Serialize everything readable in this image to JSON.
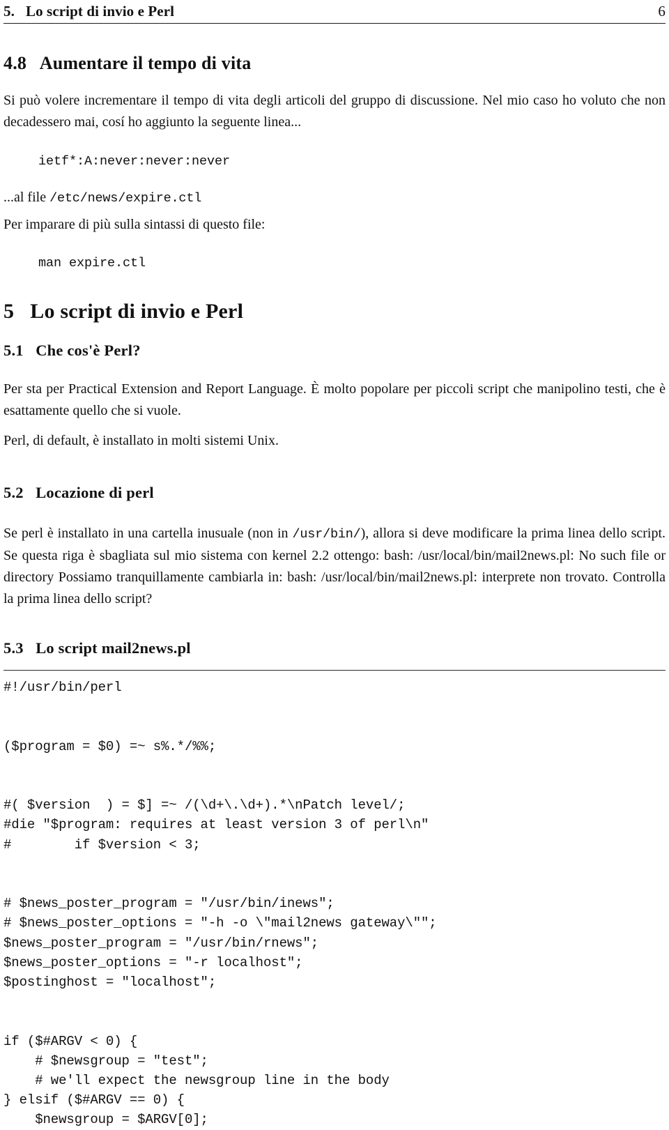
{
  "header": {
    "title": "5.   Lo script di invio e Perl",
    "page_number": "6"
  },
  "sections": {
    "s48": {
      "heading": "4.8   Aumentare il tempo di vita",
      "para1": "Si può volere incrementare il tempo di vita degli articoli del gruppo di discussione. Nel mio caso ho voluto che non decadessero mai, cosí ho aggiunto la seguente linea...",
      "verbatim1": "ietf*:A:never:never:never",
      "para2_prefix": "...al file ",
      "para2_code": "/etc/news/expire.ctl",
      "para3": "Per imparare di più sulla sintassi di questo file:",
      "verbatim2": "man expire.ctl"
    },
    "s5": {
      "heading": "5   Lo script di invio e Perl"
    },
    "s51": {
      "heading": "5.1   Che cos'è Perl?",
      "para1": "Per sta per Practical Extension and Report Language. È molto popolare per piccoli script che manipolino testi, che è esattamente quello che si vuole.",
      "para2": "Perl, di default, è installato in molti sistemi Unix."
    },
    "s52": {
      "heading": "5.2   Locazione di perl",
      "para1_a": "Se perl è installato in una cartella inusuale (non in ",
      "para1_code": "/usr/bin/",
      "para1_b": "), allora si deve modificare la prima linea dello script. Se questa riga è sbagliata sul mio sistema con kernel 2.2 ottengo: bash: /usr/local/bin/mail2news.pl: No such file or directory Possiamo tranquillamente cambiarla in: bash: /usr/local/bin/mail2news.pl: interprete non trovato. Controlla la prima linea dello script?"
    },
    "s53": {
      "heading": "5.3   Lo script mail2news.pl",
      "code_lines": [
        "#!/usr/bin/perl",
        "",
        "",
        "($program = $0) =~ s%.*/%%;",
        "",
        "",
        "#( $version  ) = $] =~ /(\\d+\\.\\d+).*\\nPatch level/;",
        "#die \"$program: requires at least version 3 of perl\\n\"",
        "#        if $version < 3;",
        "",
        "",
        "# $news_poster_program = \"/usr/bin/inews\";",
        "# $news_poster_options = \"-h -o \\\"mail2news gateway\\\"\";",
        "$news_poster_program = \"/usr/bin/rnews\";",
        "$news_poster_options = \"-r localhost\";",
        "$postinghost = \"localhost\";",
        "",
        "",
        "if ($#ARGV < 0) {",
        "    # $newsgroup = \"test\";",
        "    # we'll expect the newsgroup line in the body",
        "} elsif ($#ARGV == 0) {",
        "    $newsgroup = $ARGV[0];"
      ]
    }
  }
}
